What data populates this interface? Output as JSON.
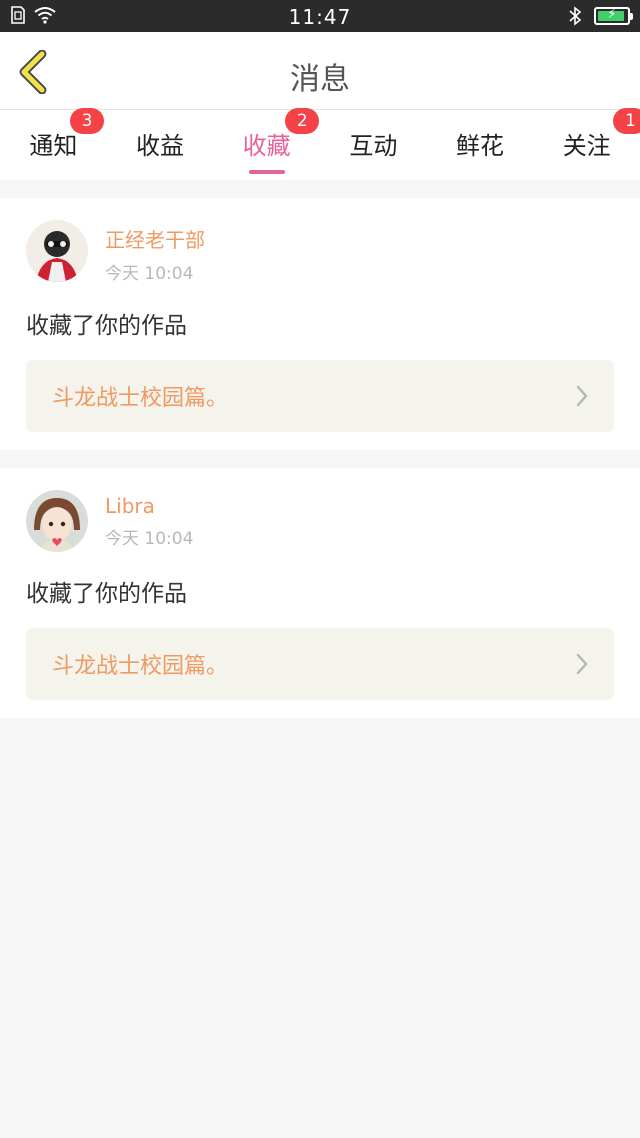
{
  "status_bar": {
    "time": "11:47"
  },
  "nav": {
    "title": "消息"
  },
  "tabs": [
    {
      "label": "通知",
      "badge": "3",
      "active": false
    },
    {
      "label": "收益",
      "badge": "",
      "active": false
    },
    {
      "label": "收藏",
      "badge": "2",
      "active": true
    },
    {
      "label": "互动",
      "badge": "",
      "active": false
    },
    {
      "label": "鲜花",
      "badge": "",
      "active": false
    },
    {
      "label": "关注",
      "badge": "1",
      "active": false
    }
  ],
  "messages": [
    {
      "user": "正经老干部",
      "time": "今天 10:04",
      "action": "收藏了你的作品",
      "work": "斗龙战士校园篇。"
    },
    {
      "user": "Libra",
      "time": "今天 10:04",
      "action": "收藏了你的作品",
      "work": "斗龙战士校园篇。"
    }
  ],
  "colors": {
    "accent_pink": "#e5629a",
    "name_orange": "#ef9a62",
    "badge_red": "#f44346",
    "back_arrow": "#f2e24a"
  },
  "icons": [
    "sim-icon",
    "wifi-icon",
    "bluetooth-icon",
    "battery-icon",
    "back-arrow-icon",
    "chevron-right-icon"
  ]
}
